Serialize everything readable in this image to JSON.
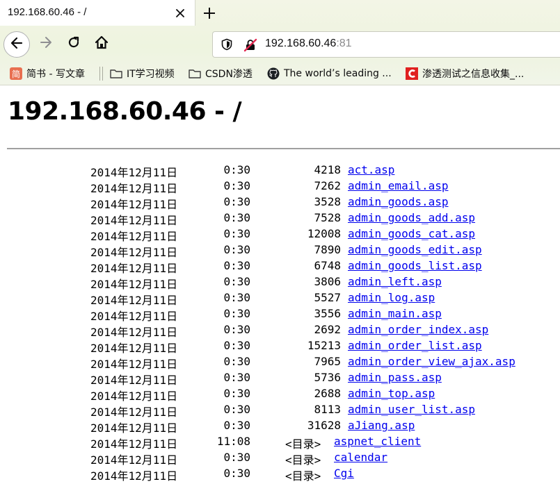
{
  "browser": {
    "tab_title": "192.168.60.46 - /",
    "url_host": "192.168.60.46",
    "url_port": ":81",
    "colors": {
      "link": "#0000ee",
      "csdn_red": "#e02020",
      "jianshu": "#e86f50"
    },
    "bookmarks": [
      {
        "label": "简书 - 写文章",
        "icon": "jianshu-icon"
      },
      {
        "label": "IT学习视频",
        "icon": "folder-icon"
      },
      {
        "label": "CSDN渗透",
        "icon": "folder-icon"
      },
      {
        "label": "The world’s leading ...",
        "icon": "github-icon"
      },
      {
        "label": "渗透测试之信息收集_...",
        "icon": "csdn-icon"
      }
    ]
  },
  "page": {
    "title": "192.168.60.46 - /",
    "entries": [
      {
        "date": "2014年12月11日",
        "time": "0:30",
        "size": "4218",
        "name": "act.asp",
        "dir": false
      },
      {
        "date": "2014年12月11日",
        "time": "0:30",
        "size": "7262",
        "name": "admin_email.asp",
        "dir": false
      },
      {
        "date": "2014年12月11日",
        "time": "0:30",
        "size": "3528",
        "name": "admin_goods.asp",
        "dir": false
      },
      {
        "date": "2014年12月11日",
        "time": "0:30",
        "size": "7528",
        "name": "admin_goods_add.asp",
        "dir": false
      },
      {
        "date": "2014年12月11日",
        "time": "0:30",
        "size": "12008",
        "name": "admin_goods_cat.asp",
        "dir": false
      },
      {
        "date": "2014年12月11日",
        "time": "0:30",
        "size": "7890",
        "name": "admin_goods_edit.asp",
        "dir": false
      },
      {
        "date": "2014年12月11日",
        "time": "0:30",
        "size": "6748",
        "name": "admin_goods_list.asp",
        "dir": false
      },
      {
        "date": "2014年12月11日",
        "time": "0:30",
        "size": "3806",
        "name": "admin_left.asp",
        "dir": false
      },
      {
        "date": "2014年12月11日",
        "time": "0:30",
        "size": "5527",
        "name": "admin_log.asp",
        "dir": false
      },
      {
        "date": "2014年12月11日",
        "time": "0:30",
        "size": "3556",
        "name": "admin_main.asp",
        "dir": false
      },
      {
        "date": "2014年12月11日",
        "time": "0:30",
        "size": "2692",
        "name": "admin_order_index.asp",
        "dir": false
      },
      {
        "date": "2014年12月11日",
        "time": "0:30",
        "size": "15213",
        "name": "admin_order_list.asp",
        "dir": false
      },
      {
        "date": "2014年12月11日",
        "time": "0:30",
        "size": "7965",
        "name": "admin_order_view_ajax.asp",
        "dir": false
      },
      {
        "date": "2014年12月11日",
        "time": "0:30",
        "size": "5736",
        "name": "admin_pass.asp",
        "dir": false
      },
      {
        "date": "2014年12月11日",
        "time": "0:30",
        "size": "2688",
        "name": "admin_top.asp",
        "dir": false
      },
      {
        "date": "2014年12月11日",
        "time": "0:30",
        "size": "8113",
        "name": "admin_user_list.asp",
        "dir": false
      },
      {
        "date": "2014年12月11日",
        "time": "0:30",
        "size": "31628",
        "name": "aJiang.asp",
        "dir": false
      },
      {
        "date": "2014年12月11日",
        "time": "11:08",
        "size": "<目录>",
        "name": "aspnet_client",
        "dir": true
      },
      {
        "date": "2014年12月11日",
        "time": "0:30",
        "size": "<目录>",
        "name": "calendar",
        "dir": true
      },
      {
        "date": "2014年12月11日",
        "time": "0:30",
        "size": "<目录>",
        "name": "Cgi",
        "dir": true
      }
    ]
  }
}
